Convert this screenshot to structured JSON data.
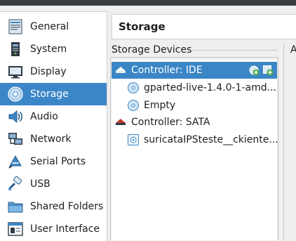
{
  "window": {
    "title": "Storage"
  },
  "sidebar": {
    "items": [
      {
        "label": "General",
        "icon": "general-icon"
      },
      {
        "label": "System",
        "icon": "system-icon"
      },
      {
        "label": "Display",
        "icon": "display-icon"
      },
      {
        "label": "Storage",
        "icon": "storage-icon",
        "selected": true
      },
      {
        "label": "Audio",
        "icon": "audio-icon"
      },
      {
        "label": "Network",
        "icon": "network-icon"
      },
      {
        "label": "Serial Ports",
        "icon": "serial-ports-icon"
      },
      {
        "label": "USB",
        "icon": "usb-icon"
      },
      {
        "label": "Shared Folders",
        "icon": "shared-folders-icon"
      },
      {
        "label": "User Interface",
        "icon": "user-interface-icon"
      }
    ]
  },
  "storage": {
    "group_label": "Storage Devices",
    "side_text": "A",
    "tree": [
      {
        "label": "Controller: IDE",
        "icon": "ide-controller-icon",
        "selected": true
      },
      {
        "label": "gparted-live-1.4.0-1-amd...",
        "icon": "optical-disc-icon"
      },
      {
        "label": "Empty",
        "icon": "optical-disc-icon"
      },
      {
        "label": "Controller: SATA",
        "icon": "sata-controller-icon"
      },
      {
        "label": "suricataIPSteste__ckiente...",
        "icon": "hard-disk-icon"
      }
    ]
  },
  "colors": {
    "selection": "#3b86c6",
    "accent_green": "#4caf50"
  }
}
